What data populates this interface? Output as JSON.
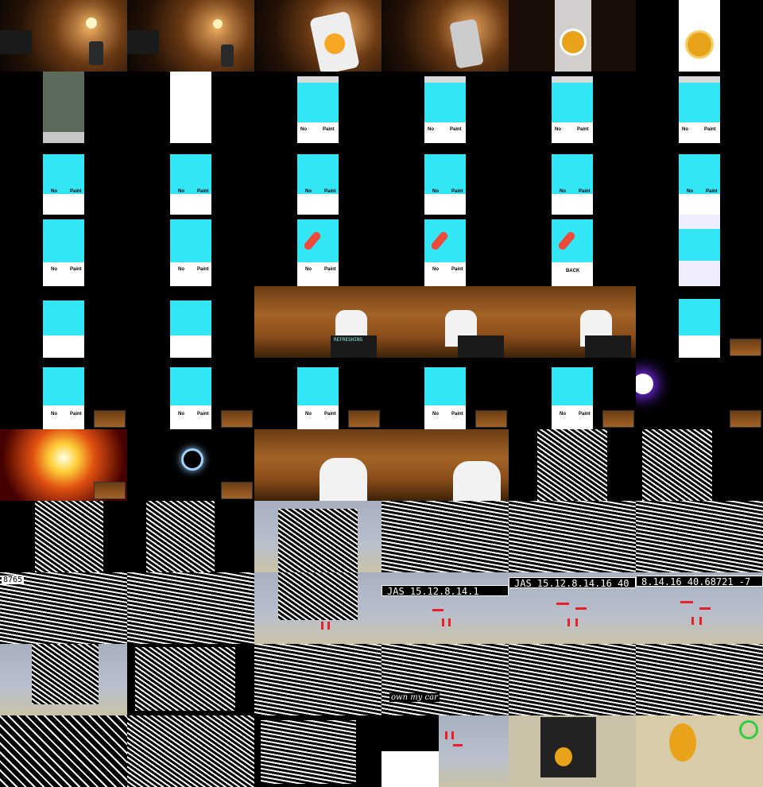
{
  "phone": {
    "left_label": "No",
    "right_label": "Paint",
    "back_label": "BACK"
  },
  "stage": {
    "screen_text": "REFRESHING"
  },
  "banners": {
    "b1": "JAS 15.12.8.14.1",
    "b2": "JAS 15.12.8.14.16 40",
    "b3": "8.14.16 40.68721 -7",
    "top_left": "8765"
  },
  "captions": {
    "car": "own my car"
  }
}
